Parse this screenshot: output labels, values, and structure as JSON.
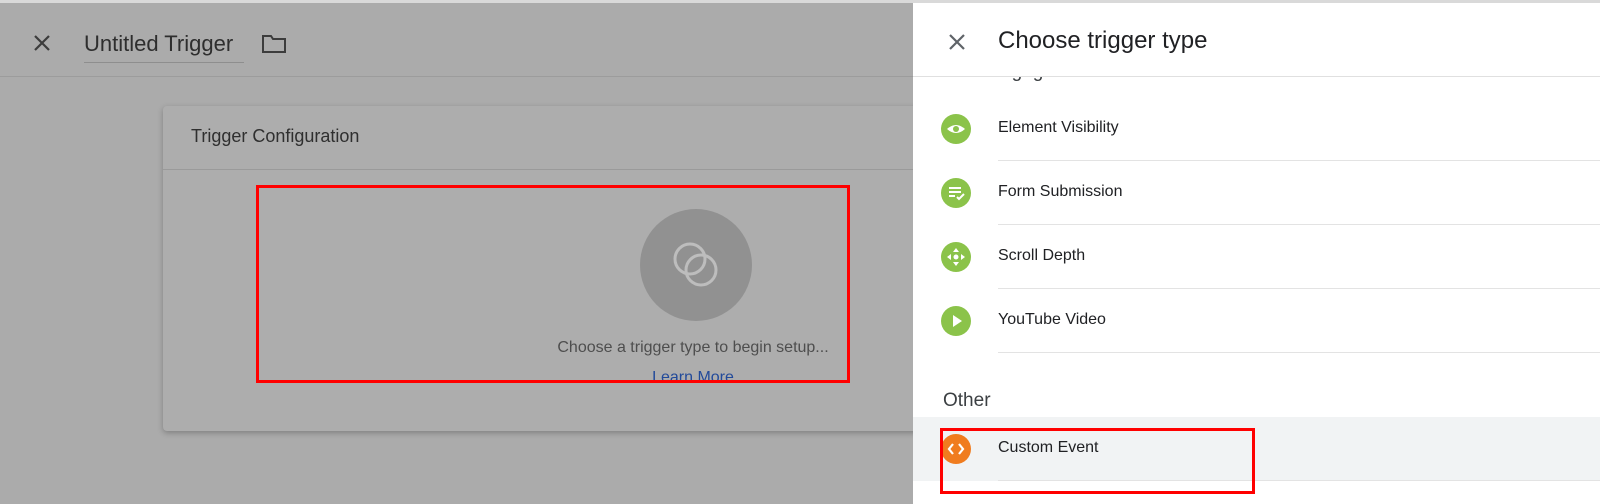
{
  "editor": {
    "title": "Untitled Trigger",
    "card_title": "Trigger Configuration",
    "hint": "Choose a trigger type to begin setup...",
    "learn_more": "Learn More"
  },
  "panel": {
    "title": "Choose trigger type",
    "partial_section": "User Engagement",
    "items": [
      {
        "label": "Element Visibility",
        "icon": "eye-icon"
      },
      {
        "label": "Form Submission",
        "icon": "form-check-icon"
      },
      {
        "label": "Scroll Depth",
        "icon": "scroll-arrows-icon"
      },
      {
        "label": "YouTube Video",
        "icon": "play-icon"
      }
    ],
    "other_section": "Other",
    "other_items": [
      {
        "label": "Custom Event",
        "icon": "code-brackets-icon"
      }
    ]
  },
  "colors": {
    "accent_green": "#8bc34a",
    "accent_orange": "#f07c1f",
    "highlight_red": "#ff0000",
    "link_blue": "#224a9a"
  }
}
